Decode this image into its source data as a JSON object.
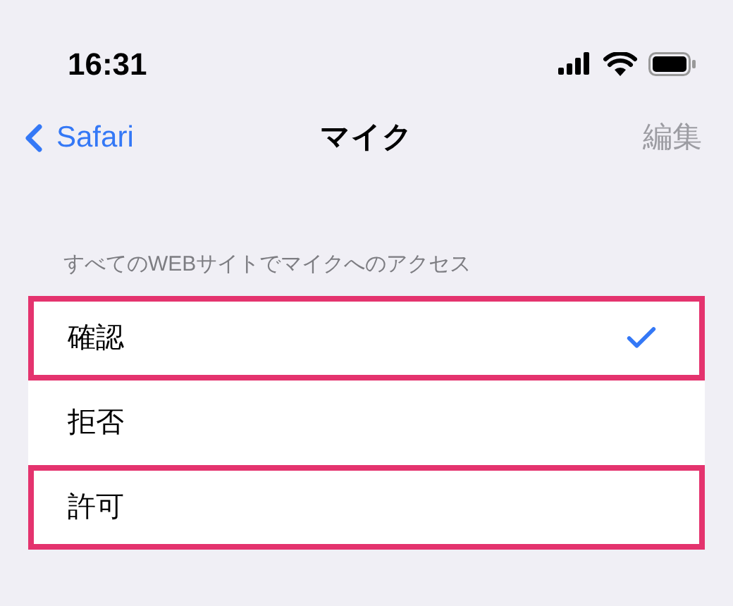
{
  "status_bar": {
    "time": "16:31"
  },
  "nav": {
    "back": "Safari",
    "title": "マイク",
    "edit": {
      "label": "編集",
      "disabled": true
    }
  },
  "section": {
    "header": "すべてのWEBサイトでマイクへのアクセス",
    "options": [
      {
        "label": "確認",
        "selected": true,
        "highlighted": true
      },
      {
        "label": "拒否",
        "selected": false,
        "highlighted": false
      },
      {
        "label": "許可",
        "selected": false,
        "highlighted": true
      }
    ]
  }
}
